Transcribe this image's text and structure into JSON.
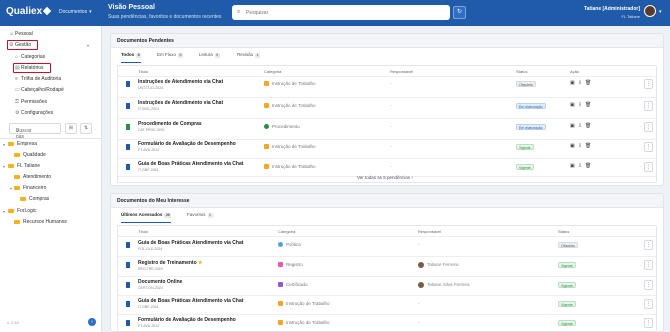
{
  "app": {
    "brand": "Qualiex",
    "module": "Documentos"
  },
  "header": {
    "title": "Visão Pessoal",
    "subtitle": "Suas pendências, favoritos e documentos recentes",
    "search_placeholder": "Pesquisar",
    "user_name": "Tatiane [Administrador]",
    "user_unit": "FL Tatiane"
  },
  "sidebar": {
    "pessoal": "Pessoal",
    "gestao": "Gestão",
    "items": [
      "Categorias",
      "Relatórios",
      "Trilha de Auditoria",
      "Cabeçalho/Rodapé",
      "Permissões",
      "Configurações"
    ],
    "search_placeholder": "Buscar pas",
    "tree": {
      "empresa": "Empresa",
      "qualidade": "Qualidade",
      "fl_tatiane": "FL Tatiane",
      "atendimento": "Atendimento",
      "financeiro": "Financeiro",
      "compras": "Compras",
      "forlogic": "ForLogic",
      "rh": "Recursos Humanos"
    },
    "version": "v. 2.33"
  },
  "pendentes": {
    "title": "Documentos Pendentes",
    "tabs": [
      {
        "label": "Todos",
        "count": "6"
      },
      {
        "label": "Em Fluxo",
        "count": "5"
      },
      {
        "label": "Leitura",
        "count": "0"
      },
      {
        "label": "Revisão",
        "count": "1"
      }
    ],
    "columns": {
      "title": "Título",
      "category": "Categoria",
      "responsible": "Responsável",
      "status": "Status",
      "actions": "Ação"
    },
    "rows": [
      {
        "title": "Instruções de Atendimento via Chat",
        "sub": "DNT-IT-01-2024",
        "category": "Instrução de Trabalho",
        "responsible": "-",
        "status": "Obsoleto",
        "status_type": "gray"
      },
      {
        "title": "Instruções de Atendimento via Chat",
        "sub": "IT-0001-2024",
        "category": "Instrução de Trabalho",
        "responsible": "-",
        "status": "Em elaboração",
        "status_type": "blue"
      },
      {
        "title": "Procedimento de Compras",
        "sub": "CAT-PROC-0001",
        "category": "Procedimento",
        "responsible": "-",
        "status": "Em elaboração",
        "status_type": "blue"
      },
      {
        "title": "Formulário de Avaliação de Desempenho",
        "sub": "FT-AVD-2024",
        "category": "Instrução de Trabalho",
        "responsible": "-",
        "status": "Vigente",
        "status_type": "green"
      },
      {
        "title": "Guia de Boas Práticas Atendimento via Chat",
        "sub": "IT-GBP-2024",
        "category": "Instrução de Trabalho",
        "responsible": "-",
        "status": "Vigente",
        "status_type": "green"
      }
    ],
    "see_more": "Ver todas as 6 pendências"
  },
  "interesse": {
    "title": "Documentos do Meu Interesse",
    "tabs": [
      {
        "label": "Últimos Acessados",
        "count": "20"
      },
      {
        "label": "Favoritos",
        "count": "1"
      }
    ],
    "columns": {
      "title": "Título",
      "category": "Categoria",
      "responsible": "Responsável",
      "status": "Status"
    },
    "rows": [
      {
        "title": "Guia de Boas Práticas Atendimento via Chat",
        "sub": "POL-GLD-2024",
        "category": "Política",
        "responsible": "-",
        "status": "Obsoleto",
        "status_type": "gray",
        "star": ""
      },
      {
        "title": "Registro de Treinamento",
        "sub": "REG-TRE-2024",
        "category": "Registro",
        "responsible": "Tatiane Ferreira",
        "status": "Vigente",
        "status_type": "green",
        "star": "★"
      },
      {
        "title": "Documento Online",
        "sub": "CERT-ON-2024",
        "category": "Certificado",
        "responsible": "Tatiane Silva Ferreira",
        "status": "Vigente",
        "status_type": "green",
        "star": ""
      },
      {
        "title": "Guia de Boas Práticas Atendimento via Chat",
        "sub": "IT-GBP-2024",
        "category": "Instrução de Trabalho",
        "responsible": "-",
        "status": "Vigente",
        "status_type": "green",
        "star": ""
      },
      {
        "title": "Formulário de Avaliação de Desempenho",
        "sub": "FT-AVD-2024",
        "category": "Instrução de Trabalho",
        "responsible": "-",
        "status": "Vigente",
        "status_type": "green",
        "star": ""
      }
    ]
  },
  "colors": {
    "primary": "#1f5ba8",
    "highlight": "#c8102e",
    "folder": "#f2b31d"
  }
}
